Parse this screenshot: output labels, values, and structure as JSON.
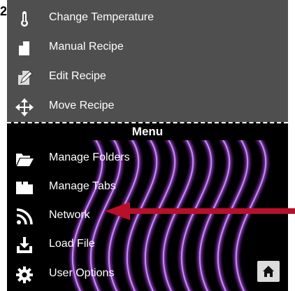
{
  "step_number": "2",
  "top_items": [
    {
      "label": "Change Temperature",
      "icon": "thermometer-icon"
    },
    {
      "label": "Manual Recipe",
      "icon": "document-icon"
    },
    {
      "label": "Edit Recipe",
      "icon": "edit-document-icon"
    },
    {
      "label": "Move Recipe",
      "icon": "move-arrows-icon"
    }
  ],
  "menu_title": "Menu",
  "menu_items": [
    {
      "label": "Manage Folders",
      "icon": "folder-open-icon"
    },
    {
      "label": "Manage Tabs",
      "icon": "tabs-icon"
    },
    {
      "label": "Network",
      "icon": "rss-network-icon"
    },
    {
      "label": "Load File",
      "icon": "download-tray-icon"
    },
    {
      "label": "User Options",
      "icon": "gear-icon"
    }
  ],
  "home_button": {
    "icon": "home-icon"
  },
  "colors": {
    "top_panel_bg": "#4f4f4f",
    "menu_bg": "#000000",
    "wave_color": "#9b3fd6",
    "annotation_arrow": "#b8102b",
    "text": "#ffffff"
  }
}
